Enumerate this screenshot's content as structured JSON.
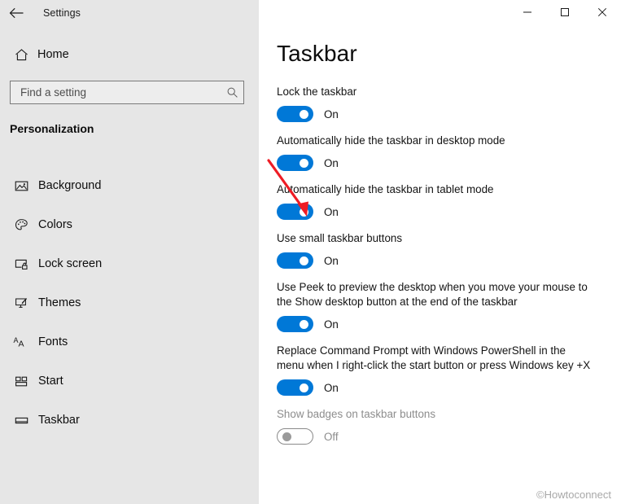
{
  "window": {
    "app_title": "Settings",
    "back_icon": "back-arrow-icon",
    "controls": {
      "minimize": "minimize-icon",
      "maximize": "maximize-icon",
      "close": "close-icon"
    }
  },
  "sidebar": {
    "home": {
      "label": "Home",
      "icon": "home-icon"
    },
    "search": {
      "value": "",
      "placeholder": "Find a setting",
      "icon": "search-icon"
    },
    "section_title": "Personalization",
    "items": [
      {
        "label": "Background",
        "icon": "picture-icon"
      },
      {
        "label": "Colors",
        "icon": "palette-icon"
      },
      {
        "label": "Lock screen",
        "icon": "lock-screen-icon"
      },
      {
        "label": "Themes",
        "icon": "themes-brush-icon"
      },
      {
        "label": "Fonts",
        "icon": "fonts-aa-icon"
      },
      {
        "label": "Start",
        "icon": "start-tiles-icon"
      },
      {
        "label": "Taskbar",
        "icon": "taskbar-icon"
      }
    ]
  },
  "main": {
    "page_title": "Taskbar",
    "settings": [
      {
        "label": "Lock the taskbar",
        "state": "On",
        "enabled": true,
        "highlighted": false
      },
      {
        "label": "Automatically hide the taskbar in desktop mode",
        "state": "On",
        "enabled": true,
        "highlighted": false
      },
      {
        "label": "Automatically hide the taskbar in tablet mode",
        "state": "On",
        "enabled": true,
        "highlighted": true
      },
      {
        "label": "Use small taskbar buttons",
        "state": "On",
        "enabled": true,
        "highlighted": false
      },
      {
        "label": "Use Peek to preview the desktop when you move your mouse to the Show desktop button at the end of the taskbar",
        "state": "On",
        "enabled": true,
        "highlighted": false
      },
      {
        "label": "Replace Command Prompt with Windows PowerShell in the menu when I right-click the start button or press Windows key +X",
        "state": "On",
        "enabled": true,
        "highlighted": false
      },
      {
        "label": "Show badges on taskbar buttons",
        "state": "Off",
        "enabled": false,
        "highlighted": false
      }
    ]
  },
  "annotation": {
    "type": "red-arrow",
    "color": "#ee1c25",
    "points_to": "Automatically hide the taskbar in tablet mode toggle"
  },
  "watermark": {
    "text": "©Howtoconnect"
  },
  "colors": {
    "accent": "#0078d7",
    "sidebar_bg": "#e6e6e6",
    "content_bg": "#ffffff",
    "disabled_text": "#8d8d8d",
    "annotation_red": "#ee1c25"
  }
}
